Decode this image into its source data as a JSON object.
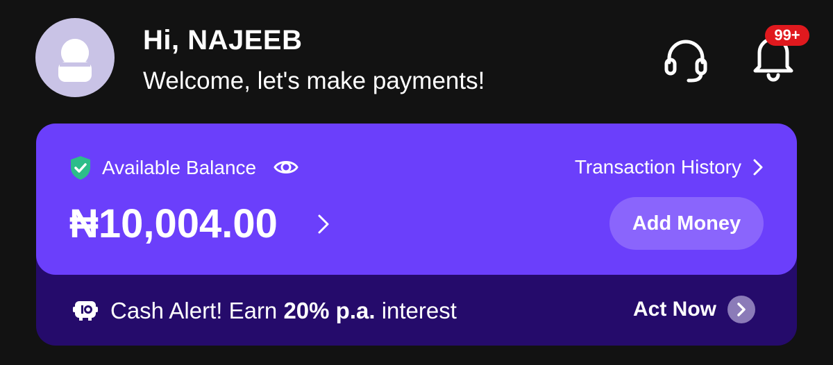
{
  "header": {
    "greeting": "Hi, NAJEEB",
    "welcome": "Welcome, let's make payments!",
    "notification_badge": "99+",
    "icons": {
      "avatar": "user-avatar-icon",
      "support": "headset-icon",
      "notifications": "bell-icon"
    }
  },
  "balance_card": {
    "label": "Available Balance",
    "amount": "₦10,004.00",
    "transaction_history_label": "Transaction History",
    "add_money_label": "Add Money",
    "icons": {
      "shield": "shield-check-icon",
      "visibility": "eye-icon",
      "chevron": "chevron-right-icon"
    }
  },
  "promo": {
    "text_prefix": "Cash Alert! Earn ",
    "text_bold": "20% p.a.",
    "text_suffix": " interest",
    "action_label": "Act Now",
    "icons": {
      "promo": "savings-box-icon",
      "action": "chevron-right-circle-icon"
    }
  },
  "colors": {
    "background": "#121212",
    "card_primary": "#6b3ffb",
    "card_secondary": "#250b6b",
    "button": "#8a65fc",
    "badge": "#e0191e",
    "shield": "#2dbd8a",
    "avatar_bg": "#c9c3e6"
  }
}
